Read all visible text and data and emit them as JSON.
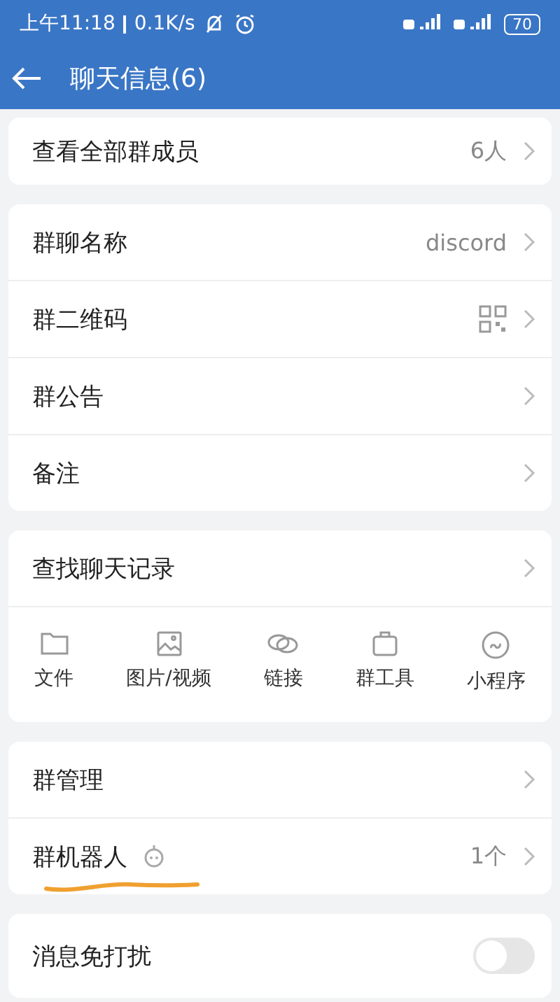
{
  "status_bar": {
    "time": "上午11:18",
    "speed": "0.1K/s",
    "battery": "70"
  },
  "header": {
    "title": "聊天信息(6)"
  },
  "sections": [
    {
      "rows": [
        {
          "kind": "value",
          "label": "查看全部群成员",
          "value": "6人"
        }
      ]
    },
    {
      "rows": [
        {
          "kind": "value",
          "label": "群聊名称",
          "value": "discord"
        },
        {
          "kind": "qr",
          "label": "群二维码"
        },
        {
          "kind": "plain",
          "label": "群公告"
        },
        {
          "kind": "plain",
          "label": "备注"
        }
      ]
    },
    {
      "rows": [
        {
          "kind": "plain",
          "label": "查找聊天记录"
        }
      ],
      "tools": [
        {
          "kind": "folder",
          "label": "文件"
        },
        {
          "kind": "image",
          "label": "图片/视频"
        },
        {
          "kind": "link",
          "label": "链接"
        },
        {
          "kind": "bag",
          "label": "群工具"
        },
        {
          "kind": "mini",
          "label": "小程序"
        }
      ]
    },
    {
      "rows": [
        {
          "kind": "plain",
          "label": "群管理"
        },
        {
          "kind": "robot",
          "label": "群机器人",
          "value": "1个",
          "underlined": true
        }
      ]
    },
    {
      "rows": [
        {
          "kind": "toggle",
          "label": "消息免打扰",
          "on": false
        }
      ]
    }
  ]
}
